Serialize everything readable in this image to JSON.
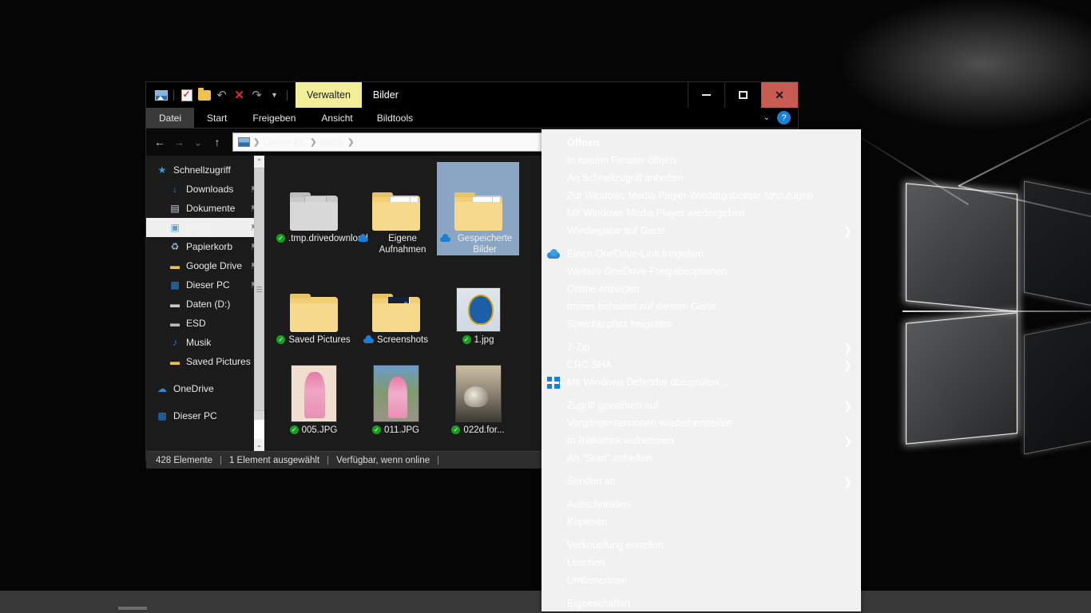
{
  "window": {
    "title": "Bilder",
    "contextual_tab": "Verwalten",
    "quick_access": [
      {
        "name": "picture-properties-icon",
        "glyph": "pic"
      },
      {
        "name": "properties-icon",
        "glyph": "props"
      },
      {
        "name": "new-folder-icon",
        "glyph": "folder"
      },
      {
        "name": "undo-icon",
        "glyph": "↶"
      },
      {
        "name": "delete-icon",
        "glyph": "✕"
      },
      {
        "name": "redo-icon",
        "glyph": "↷"
      },
      {
        "name": "customize-qat-icon",
        "glyph": "▾"
      }
    ],
    "controls": {
      "minimize": "–",
      "maximize": "▫",
      "close": "✕"
    }
  },
  "ribbon": {
    "tabs": [
      {
        "label": "Datei",
        "active": true
      },
      {
        "label": "Start",
        "active": false
      },
      {
        "label": "Freigeben",
        "active": false
      },
      {
        "label": "Ansicht",
        "active": false
      },
      {
        "label": "Bildtools",
        "active": false
      }
    ],
    "expand_icon": "⌄",
    "help_icon": "?"
  },
  "address": {
    "back_icon": "←",
    "forward_icon": "→",
    "recent_icon": "⌄",
    "up_icon": "↑",
    "crumbs": [
      "Dieser PC",
      "Bilder"
    ],
    "separator": "❯"
  },
  "sidebar": {
    "items": [
      {
        "label": "Schnellzugriff",
        "icon": "★",
        "depth": 0,
        "pin": false,
        "selected": false,
        "icon_color": "#3a9bd8"
      },
      {
        "label": "Downloads",
        "icon": "↓",
        "depth": 1,
        "pin": true,
        "selected": false,
        "icon_color": "#2a7fd4"
      },
      {
        "label": "Dokumente",
        "icon": "☰",
        "depth": 1,
        "pin": true,
        "selected": false,
        "icon_color": "#cfd6de"
      },
      {
        "label": "Bilder",
        "icon": "▣",
        "depth": 1,
        "pin": true,
        "selected": true,
        "icon_color": "#8fb9dc"
      },
      {
        "label": "Papierkorb",
        "icon": "♻",
        "depth": 1,
        "pin": true,
        "selected": false,
        "icon_color": "#9fb7c9"
      },
      {
        "label": "Google Drive",
        "icon": "▬",
        "depth": 1,
        "pin": true,
        "selected": false,
        "icon_color": "#f2c14b"
      },
      {
        "label": "Dieser PC",
        "icon": "■",
        "depth": 1,
        "pin": true,
        "selected": false,
        "icon_color": "#2a7fd4"
      },
      {
        "label": "Daten (D:)",
        "icon": "▬",
        "depth": 1,
        "pin": false,
        "selected": false,
        "icon_color": "#c9c9c9"
      },
      {
        "label": "ESD",
        "icon": "▬",
        "depth": 1,
        "pin": false,
        "selected": false,
        "icon_color": "#b9b9b9"
      },
      {
        "label": "Musik",
        "icon": "♪",
        "depth": 1,
        "pin": false,
        "selected": false,
        "icon_color": "#2a7fd4"
      },
      {
        "label": "Saved Pictures",
        "icon": "▬",
        "depth": 1,
        "pin": false,
        "selected": false,
        "icon_color": "#f2c14b"
      },
      {
        "label": "OneDrive",
        "icon": "☁",
        "depth": 0,
        "pin": false,
        "selected": false,
        "icon_color": "#2a8ad4"
      },
      {
        "label": "Dieser PC",
        "icon": "■",
        "depth": 0,
        "pin": false,
        "selected": false,
        "icon_color": "#2a7fd4"
      }
    ],
    "pin_icon": "⚑",
    "scroll_up": "⌃",
    "scroll_down": "⌄"
  },
  "files": {
    "rows": [
      [
        {
          "name": ".tmp.drivedownload",
          "kind": "folder-gray",
          "badge": "check"
        },
        {
          "name": "Eigene Aufnahmen",
          "kind": "folder-pics",
          "badge": "cloud"
        },
        {
          "name": "Gespeicherte Bilder",
          "kind": "folder-pics",
          "badge": "cloud",
          "selected": true
        },
        {
          "name": "",
          "kind": "none",
          "badge": "cloud"
        }
      ],
      [
        {
          "name": "Saved Pictures",
          "kind": "folder-plain",
          "badge": "check"
        },
        {
          "name": "Screenshots",
          "kind": "folder-dark",
          "badge": "cloud"
        },
        {
          "name": "1.jpg",
          "kind": "photo-fcp",
          "badge": "check"
        }
      ],
      [
        {
          "name": "005.JPG",
          "kind": "photo-005",
          "badge": "check"
        },
        {
          "name": "011.JPG",
          "kind": "photo-011",
          "badge": "check"
        },
        {
          "name": "022d.for...",
          "kind": "photo-022",
          "badge": "check"
        }
      ]
    ]
  },
  "status": {
    "items_count": "428 Elemente",
    "selection": "1 Element ausgewählt",
    "availability": "Verfügbar, wenn online",
    "separator": "|"
  },
  "context_menu": {
    "items": [
      {
        "label": "Öffnen",
        "bold": true,
        "arrow": false,
        "icon": null
      },
      {
        "label": "In neuem Fenster öffnen",
        "bold": false,
        "arrow": false,
        "icon": null
      },
      {
        "label": "An Schnellzugriff anheften",
        "bold": false,
        "arrow": false,
        "icon": null
      },
      {
        "label": "Zur Windows Media Player-Wiedergabeliste hinzufügen",
        "bold": false,
        "arrow": false,
        "icon": null
      },
      {
        "label": "Mit Windows Media Player wiedergeben",
        "bold": false,
        "arrow": false,
        "icon": null
      },
      {
        "label": "Wiedergabe auf Gerät",
        "bold": false,
        "arrow": true,
        "icon": null
      },
      {
        "separator": true
      },
      {
        "label": "Einen OneDrive-Link freigeben",
        "bold": false,
        "arrow": false,
        "icon": "onedrive"
      },
      {
        "label": "Weitere OneDrive-Freigabeoptionen",
        "bold": false,
        "arrow": false,
        "icon": null
      },
      {
        "label": "Online anzeigen",
        "bold": false,
        "arrow": false,
        "icon": null
      },
      {
        "label": "Immer behalten auf diesem Gerät",
        "bold": false,
        "arrow": false,
        "icon": null
      },
      {
        "label": "Speicherplatz freigeben",
        "bold": false,
        "arrow": false,
        "icon": null
      },
      {
        "separator": true
      },
      {
        "label": "7-Zip",
        "bold": false,
        "arrow": true,
        "icon": null
      },
      {
        "label": "CRC SHA",
        "bold": false,
        "arrow": true,
        "icon": null
      },
      {
        "label": "Mit Windows Defender überprüfen...",
        "bold": false,
        "arrow": false,
        "icon": "defender"
      },
      {
        "separator": true
      },
      {
        "label": "Zugriff gewähren auf",
        "bold": false,
        "arrow": true,
        "icon": null
      },
      {
        "label": "Vorgängerversionen wiederherstellen",
        "bold": false,
        "arrow": false,
        "icon": null
      },
      {
        "label": "In Bibliothek aufnehmen",
        "bold": false,
        "arrow": true,
        "icon": null
      },
      {
        "label": "An \"Start\" anheften",
        "bold": false,
        "arrow": false,
        "icon": null
      },
      {
        "separator": true
      },
      {
        "label": "Senden an",
        "bold": false,
        "arrow": true,
        "icon": null
      },
      {
        "separator": true
      },
      {
        "label": "Ausschneiden",
        "bold": false,
        "arrow": false,
        "icon": null
      },
      {
        "label": "Kopieren",
        "bold": false,
        "arrow": false,
        "icon": null
      },
      {
        "separator": true
      },
      {
        "label": "Verknüpfung erstellen",
        "bold": false,
        "arrow": false,
        "icon": null
      },
      {
        "label": "Löschen",
        "bold": false,
        "arrow": false,
        "icon": null
      },
      {
        "label": "Umbenennen",
        "bold": false,
        "arrow": false,
        "icon": null
      },
      {
        "separator": true
      },
      {
        "label": "Eigenschaften",
        "bold": false,
        "arrow": false,
        "icon": null
      }
    ],
    "arrow_glyph": "❯"
  },
  "colors": {
    "accent": "#1b7fd4",
    "contextual_tab": "#f2ee9a",
    "close_button": "#c75b52",
    "selection": "#8ba6c4",
    "menu_bg": "#f1f1f1",
    "check_badge": "#15a01e"
  }
}
